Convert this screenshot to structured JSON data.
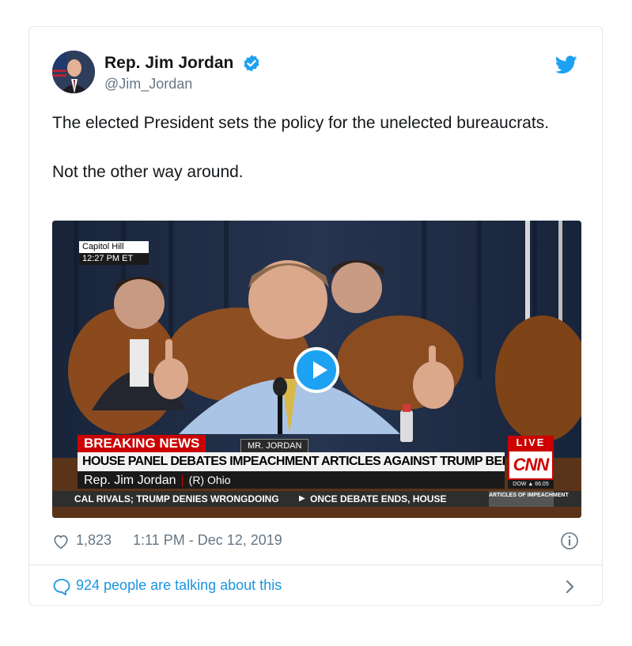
{
  "tweet": {
    "display_name": "Rep. Jim Jordan",
    "handle": "@Jim_Jordan",
    "text_lines": [
      "The elected President sets the policy for the unelected bureaucrats.",
      "Not the other way around."
    ],
    "likes": "1,823",
    "timestamp": "1:11 PM - Dec 12, 2019",
    "talking": "924 people are talking about this"
  },
  "video": {
    "location": "Capitol Hill",
    "time": "12:27 PM ET",
    "breaking": "BREAKING NEWS",
    "speaker_tag": "MR. JORDAN",
    "headline": "HOUSE PANEL DEBATES IMPEACHMENT ARTICLES AGAINST TRUMP BEFORE VOTE",
    "speaker": "Rep. Jim Jordan",
    "party": "(R) Ohio",
    "live": "LIVE",
    "network": "CNN",
    "dow": "DOW ▲ 66.05",
    "ticker_left": "CAL RIVALS; TRUMP DENIES WRONGDOING",
    "ticker_right": "ONCE DEBATE ENDS, HOUSE",
    "ticker_badge": "ARTICLES OF IMPEACHMENT"
  },
  "icons": {
    "verified": "verified-badge-icon",
    "bird": "twitter-bird-icon",
    "heart": "heart-icon",
    "info": "info-icon",
    "bubble": "reply-bubble-icon",
    "chevron": "chevron-right-icon",
    "play": "play-icon"
  },
  "colors": {
    "twitter_blue": "#1da1f2",
    "link_blue": "#1b95e0",
    "muted": "#657786",
    "border": "#e1e8ed",
    "cnn_red": "#cc0000"
  }
}
